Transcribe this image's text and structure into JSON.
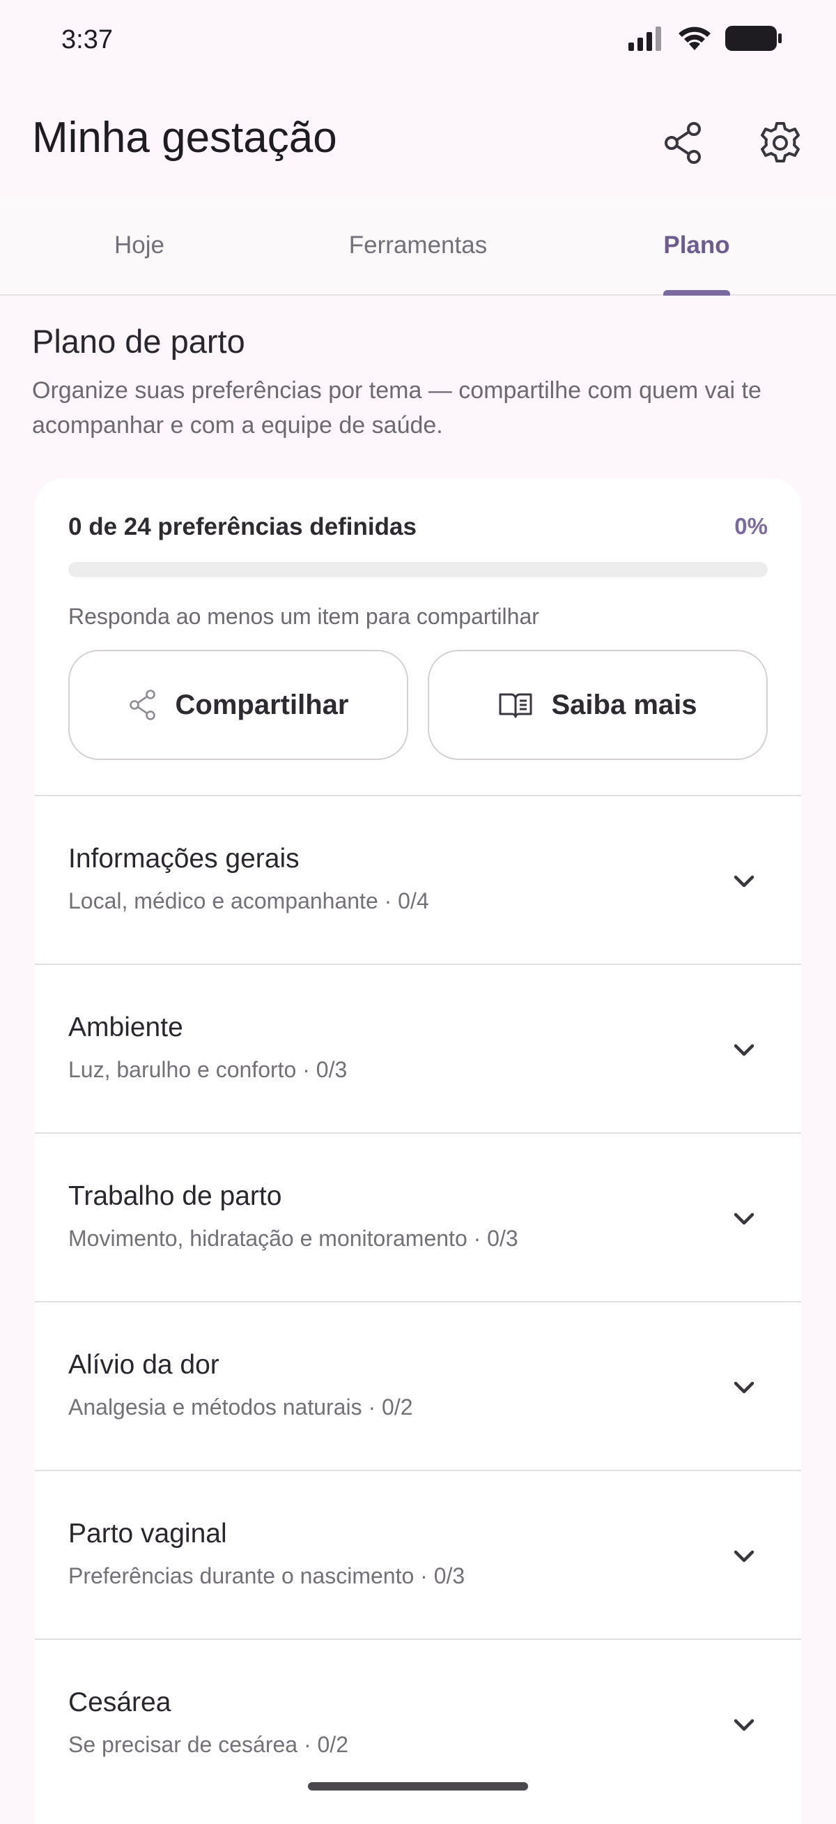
{
  "status_bar": {
    "time": "3:37"
  },
  "app_bar": {
    "title": "Minha gestação"
  },
  "tabs": [
    {
      "label": "Hoje",
      "active": false
    },
    {
      "label": "Ferramentas",
      "active": false
    },
    {
      "label": "Plano",
      "active": true
    }
  ],
  "intro": {
    "title": "Plano de parto",
    "description": "Organize suas preferências por tema — compartilhe com quem vai te acompanhar e com a equipe de saúde."
  },
  "progress": {
    "label": "0 de 24 preferências definidas",
    "percent_label": "0%",
    "fraction": 0,
    "hint": "Responda ao menos um item para compartilhar"
  },
  "actions": {
    "share_label": "Compartilhar",
    "learn_label": "Saiba mais"
  },
  "sections": [
    {
      "title": "Informações gerais",
      "subtitle": "Local, médico e acompanhante · 0/4"
    },
    {
      "title": "Ambiente",
      "subtitle": "Luz, barulho e conforto · 0/3"
    },
    {
      "title": "Trabalho de parto",
      "subtitle": "Movimento, hidratação e monitoramento · 0/3"
    },
    {
      "title": "Alívio da dor",
      "subtitle": "Analgesia e métodos naturais · 0/2"
    },
    {
      "title": "Parto vaginal",
      "subtitle": "Preferências durante o nascimento · 0/3"
    },
    {
      "title": "Cesárea",
      "subtitle": "Se precisar de cesárea · 0/2"
    }
  ],
  "colors": {
    "accent": "#7b6a9d",
    "background": "#fdf6fb",
    "card": "#ffffff"
  },
  "icons": {
    "share": "share-icon",
    "settings": "gear-icon",
    "book": "book-icon",
    "chevron": "chevron-down-icon"
  }
}
